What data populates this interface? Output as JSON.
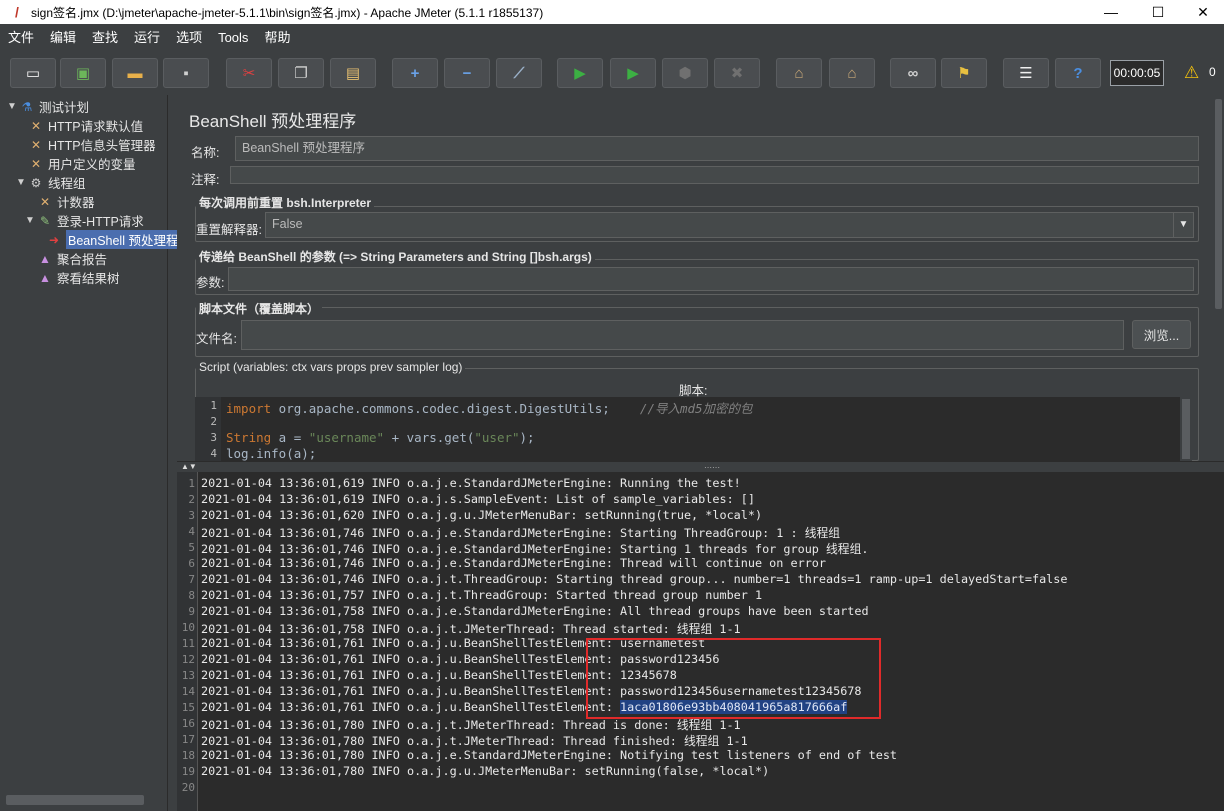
{
  "window": {
    "title": "sign签名.jmx (D:\\jmeter\\apache-jmeter-5.1.1\\bin\\sign签名.jmx) - Apache JMeter (5.1.1 r1855137)",
    "controls": {
      "minimize": "—",
      "maximize": "☐",
      "close": "✕"
    }
  },
  "menu": [
    "文件",
    "编辑",
    "查找",
    "运行",
    "选项",
    "Tools",
    "帮助"
  ],
  "toolbar": {
    "timer": "00:00:05",
    "warnings": "0",
    "buttons": [
      {
        "name": "new",
        "glyph": "▭",
        "color": "#f0f0f0"
      },
      {
        "name": "templates",
        "glyph": "▣",
        "color": "#6cb65a"
      },
      {
        "name": "open",
        "glyph": "▬",
        "color": "#e8b04a"
      },
      {
        "name": "save",
        "glyph": "▪",
        "color": "#d0d0d0"
      },
      {
        "name": "cut",
        "glyph": "✂",
        "color": "#e04040"
      },
      {
        "name": "copy",
        "glyph": "❐",
        "color": "#d0d0d0"
      },
      {
        "name": "paste",
        "glyph": "▤",
        "color": "#e8c070"
      },
      {
        "name": "expand",
        "glyph": "+",
        "color": "#6aa2e8"
      },
      {
        "name": "collapse",
        "glyph": "−",
        "color": "#6aa2e8"
      },
      {
        "name": "toggle",
        "glyph": "⟋",
        "color": "#9ab0c8"
      },
      {
        "name": "start",
        "glyph": "▶",
        "color": "#3cb043"
      },
      {
        "name": "start-no-pause",
        "glyph": "▶",
        "color": "#3cb043"
      },
      {
        "name": "stop",
        "glyph": "⬢",
        "color": "#707070"
      },
      {
        "name": "shutdown",
        "glyph": "✖",
        "color": "#707070"
      },
      {
        "name": "clear",
        "glyph": "⌂",
        "color": "#c8a878"
      },
      {
        "name": "clear-all",
        "glyph": "⌂",
        "color": "#c8a878"
      },
      {
        "name": "search",
        "glyph": "∞",
        "color": "#d0d0d0"
      },
      {
        "name": "reset-search",
        "glyph": "⚑",
        "color": "#e8c040"
      },
      {
        "name": "function-helper",
        "glyph": "☰",
        "color": "#f0f0f0"
      },
      {
        "name": "help",
        "glyph": "?",
        "color": "#4a8ee0"
      }
    ]
  },
  "tree": [
    {
      "label": "测试计划",
      "indent": 0,
      "toggle": "▼",
      "icon": "flask-icon",
      "glyph": "⚗",
      "color": "#4a8ee0"
    },
    {
      "label": "HTTP请求默认值",
      "indent": 1,
      "toggle": "",
      "icon": "wrench-icon",
      "glyph": "✕",
      "color": "#e0b070"
    },
    {
      "label": "HTTP信息头管理器",
      "indent": 1,
      "toggle": "",
      "icon": "wrench-icon",
      "glyph": "✕",
      "color": "#e0b070"
    },
    {
      "label": "用户定义的变量",
      "indent": 1,
      "toggle": "",
      "icon": "wrench-icon",
      "glyph": "✕",
      "color": "#e0b070"
    },
    {
      "label": "线程组",
      "indent": 1,
      "toggle": "▼",
      "icon": "gear-icon",
      "glyph": "⚙",
      "color": "#d0d0d0"
    },
    {
      "label": "计数器",
      "indent": 2,
      "toggle": "",
      "icon": "wrench-icon",
      "glyph": "✕",
      "color": "#e0b070"
    },
    {
      "label": "登录-HTTP请求",
      "indent": 2,
      "toggle": "▼",
      "icon": "pen-icon",
      "glyph": "✎",
      "color": "#8ec07c"
    },
    {
      "label": "BeanShell 预处理程",
      "indent": 3,
      "toggle": "",
      "icon": "script-icon",
      "glyph": "➜",
      "color": "#e04040",
      "selected": true
    },
    {
      "label": "聚合报告",
      "indent": 2,
      "toggle": "",
      "icon": "chart-icon",
      "glyph": "▲",
      "color": "#c890e0"
    },
    {
      "label": "察看结果树",
      "indent": 2,
      "toggle": "",
      "icon": "chart-icon",
      "glyph": "▲",
      "color": "#c890e0"
    }
  ],
  "panel": {
    "title": "BeanShell 预处理程序",
    "name_label": "名称:",
    "name_value": "BeanShell 预处理程序",
    "comment_label": "注释:",
    "comment_value": "",
    "reset_group_title": "每次调用前重置 bsh.Interpreter",
    "reset_label": "重置解释器:",
    "reset_value": "False",
    "params_group_title": "传递给 BeanShell 的参数 (=> String Parameters and String []bsh.args)",
    "params_label": "参数:",
    "params_value": "",
    "file_group_title": "脚本文件（覆盖脚本）",
    "file_label": "文件名:",
    "file_value": "",
    "browse_label": "浏览...",
    "script_group_title": "Script (variables: ctx vars props prev sampler log)",
    "script_label": "脚本:"
  },
  "script": [
    {
      "num": "1",
      "parts": [
        {
          "t": "import",
          "c": "kw"
        },
        {
          "t": " org.apache.commons.codec.digest.DigestUtils;    ",
          "c": ""
        },
        {
          "t": "//导入md5加密的包",
          "c": "cmt"
        }
      ]
    },
    {
      "num": "2",
      "parts": []
    },
    {
      "num": "3",
      "parts": [
        {
          "t": "String",
          "c": "kw"
        },
        {
          "t": " a = ",
          "c": ""
        },
        {
          "t": "\"username\"",
          "c": "str"
        },
        {
          "t": " + vars.get(",
          "c": ""
        },
        {
          "t": "\"user\"",
          "c": "str"
        },
        {
          "t": ");",
          "c": ""
        }
      ]
    },
    {
      "num": "4",
      "parts": [
        {
          "t": "log.info(a);",
          "c": ""
        }
      ]
    }
  ],
  "log": [
    {
      "num": "1",
      "text": "2021-01-04 13:36:01,619 INFO o.a.j.e.StandardJMeterEngine: Running the test!"
    },
    {
      "num": "2",
      "text": "2021-01-04 13:36:01,619 INFO o.a.j.s.SampleEvent: List of sample_variables: []"
    },
    {
      "num": "3",
      "text": "2021-01-04 13:36:01,620 INFO o.a.j.g.u.JMeterMenuBar: setRunning(true, *local*)"
    },
    {
      "num": "4",
      "text": "2021-01-04 13:36:01,746 INFO o.a.j.e.StandardJMeterEngine: Starting ThreadGroup: 1 : 线程组"
    },
    {
      "num": "5",
      "text": "2021-01-04 13:36:01,746 INFO o.a.j.e.StandardJMeterEngine: Starting 1 threads for group 线程组."
    },
    {
      "num": "6",
      "text": "2021-01-04 13:36:01,746 INFO o.a.j.e.StandardJMeterEngine: Thread will continue on error"
    },
    {
      "num": "7",
      "text": "2021-01-04 13:36:01,746 INFO o.a.j.t.ThreadGroup: Starting thread group... number=1 threads=1 ramp-up=1 delayedStart=false"
    },
    {
      "num": "8",
      "text": "2021-01-04 13:36:01,757 INFO o.a.j.t.ThreadGroup: Started thread group number 1"
    },
    {
      "num": "9",
      "text": "2021-01-04 13:36:01,758 INFO o.a.j.e.StandardJMeterEngine: All thread groups have been started"
    },
    {
      "num": "10",
      "text": "2021-01-04 13:36:01,758 INFO o.a.j.t.JMeterThread: Thread started: 线程组 1-1"
    },
    {
      "num": "11",
      "text": "2021-01-04 13:36:01,761 INFO o.a.j.u.BeanShellTestElement: usernametest"
    },
    {
      "num": "12",
      "text": "2021-01-04 13:36:01,761 INFO o.a.j.u.BeanShellTestElement: password123456"
    },
    {
      "num": "13",
      "text": "2021-01-04 13:36:01,761 INFO o.a.j.u.BeanShellTestElement: 12345678"
    },
    {
      "num": "14",
      "text": "2021-01-04 13:36:01,761 INFO o.a.j.u.BeanShellTestElement: password123456usernametest12345678"
    },
    {
      "num": "15",
      "text": "2021-01-04 13:36:01,761 INFO o.a.j.u.BeanShellTestElement: ",
      "highlight": "1aca01806e93bb408041965a817666af"
    },
    {
      "num": "16",
      "text": "2021-01-04 13:36:01,780 INFO o.a.j.t.JMeterThread: Thread is done: 线程组 1-1"
    },
    {
      "num": "17",
      "text": "2021-01-04 13:36:01,780 INFO o.a.j.t.JMeterThread: Thread finished: 线程组 1-1"
    },
    {
      "num": "18",
      "text": "2021-01-04 13:36:01,780 INFO o.a.j.e.StandardJMeterEngine: Notifying test listeners of end of test"
    },
    {
      "num": "19",
      "text": "2021-01-04 13:36:01,780 INFO o.a.j.g.u.JMeterMenuBar: setRunning(false, *local*)"
    },
    {
      "num": "20",
      "text": ""
    }
  ],
  "colors": {
    "accent": "#4b6eaf",
    "annotation": "#e02a2a",
    "selection": "#214283"
  }
}
